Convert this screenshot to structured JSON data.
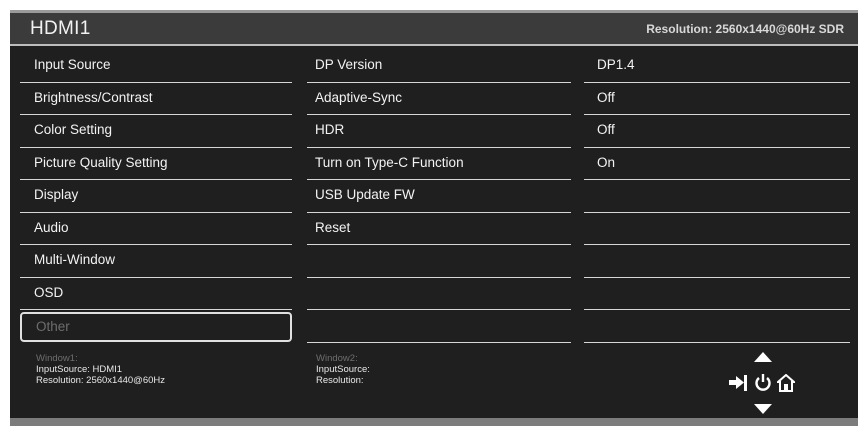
{
  "header": {
    "title": "HDMI1",
    "resolution": "Resolution: 2560x1440@60Hz SDR"
  },
  "menu": {
    "main": [
      "Input Source",
      "Brightness/Contrast",
      "Color Setting",
      "Picture Quality Setting",
      "Display",
      "Audio",
      "Multi-Window",
      "OSD",
      "Other"
    ],
    "selected_index": 8,
    "sub": [
      "DP Version",
      "Adaptive-Sync",
      "HDR",
      "Turn on Type-C Function",
      "USB Update FW",
      "Reset",
      "",
      "",
      ""
    ],
    "values": [
      "DP1.4",
      "Off",
      "Off",
      "On",
      "",
      "",
      "",
      "",
      ""
    ]
  },
  "window1": {
    "title": "Window1:",
    "input": "InputSource: HDMI1",
    "resolution": "Resolution: 2560x1440@60Hz"
  },
  "window2": {
    "title": "Window2:",
    "input": "InputSource:",
    "resolution": "Resolution:"
  },
  "nav_icons": [
    "up-arrow-icon",
    "exit-icon",
    "power-icon",
    "home-icon",
    "down-arrow-icon"
  ],
  "colors": {
    "background": "#1f1f1f",
    "header": "#3b3b3b",
    "text": "#f3f3f3",
    "disabled_text": "#6d6d6d"
  }
}
